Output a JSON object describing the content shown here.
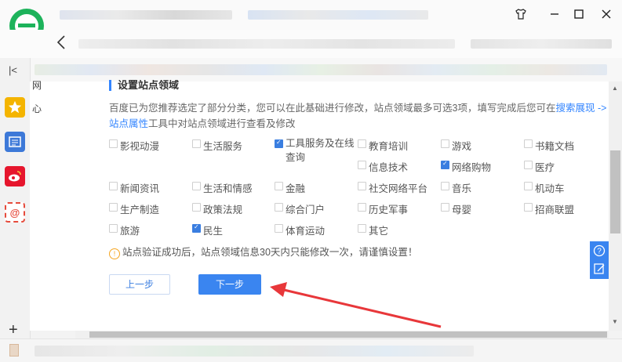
{
  "window": {
    "controls": [
      "shirt-icon",
      "minimize-icon",
      "maximize-icon",
      "close-icon"
    ]
  },
  "sidebar": {
    "collapse_glyph": "|<",
    "add_glyph": "+",
    "icons": [
      "favorites-star-icon",
      "reader-icon",
      "weibo-icon",
      "mail-icon"
    ]
  },
  "leftnav": {
    "items": [
      "网",
      "心"
    ]
  },
  "section": {
    "title": "设置站点领域",
    "intro_prefix": "百度已为您推荐选定了部分分类，您可以在此基础进行修改，站点领域最多可选3项，填写完成后您可在",
    "link1": "搜索展现 -> 站点属性",
    "intro_suffix": "工具中对站点领域进行查看及修改"
  },
  "categories": [
    {
      "label": "影视动漫",
      "checked": false
    },
    {
      "label": "生活服务",
      "checked": false
    },
    {
      "label": "工具服务及在线查询",
      "checked": true
    },
    {
      "label": "教育培训",
      "checked": false
    },
    {
      "label": "游戏",
      "checked": false
    },
    {
      "label": "书籍文档",
      "checked": false
    },
    {
      "label": "信息技术",
      "checked": false
    },
    {
      "label": "网络购物",
      "checked": true
    },
    {
      "label": "医疗",
      "checked": false
    },
    {
      "label": "新闻资讯",
      "checked": false
    },
    {
      "label": "生活和情感",
      "checked": false
    },
    {
      "label": "金融",
      "checked": false
    },
    {
      "label": "社交网络平台",
      "checked": false
    },
    {
      "label": "音乐",
      "checked": false
    },
    {
      "label": "机动车",
      "checked": false
    },
    {
      "label": "生产制造",
      "checked": false
    },
    {
      "label": "政策法规",
      "checked": false
    },
    {
      "label": "综合门户",
      "checked": false
    },
    {
      "label": "历史军事",
      "checked": false
    },
    {
      "label": "母婴",
      "checked": false
    },
    {
      "label": "招商联盟",
      "checked": false
    },
    {
      "label": "旅游",
      "checked": false
    },
    {
      "label": "民生",
      "checked": true
    },
    {
      "label": "体育运动",
      "checked": false
    },
    {
      "label": "其它",
      "checked": false
    }
  ],
  "notice": "站点验证成功后，站点领域信息30天内只能修改一次，请谨慎设置！",
  "buttons": {
    "prev": "上一步",
    "next": "下一步"
  },
  "floating": [
    "help-icon",
    "feedback-icon"
  ],
  "colors": {
    "accent": "#3a85f0",
    "arrow": "#e8373a",
    "logo": "#1db35b"
  }
}
